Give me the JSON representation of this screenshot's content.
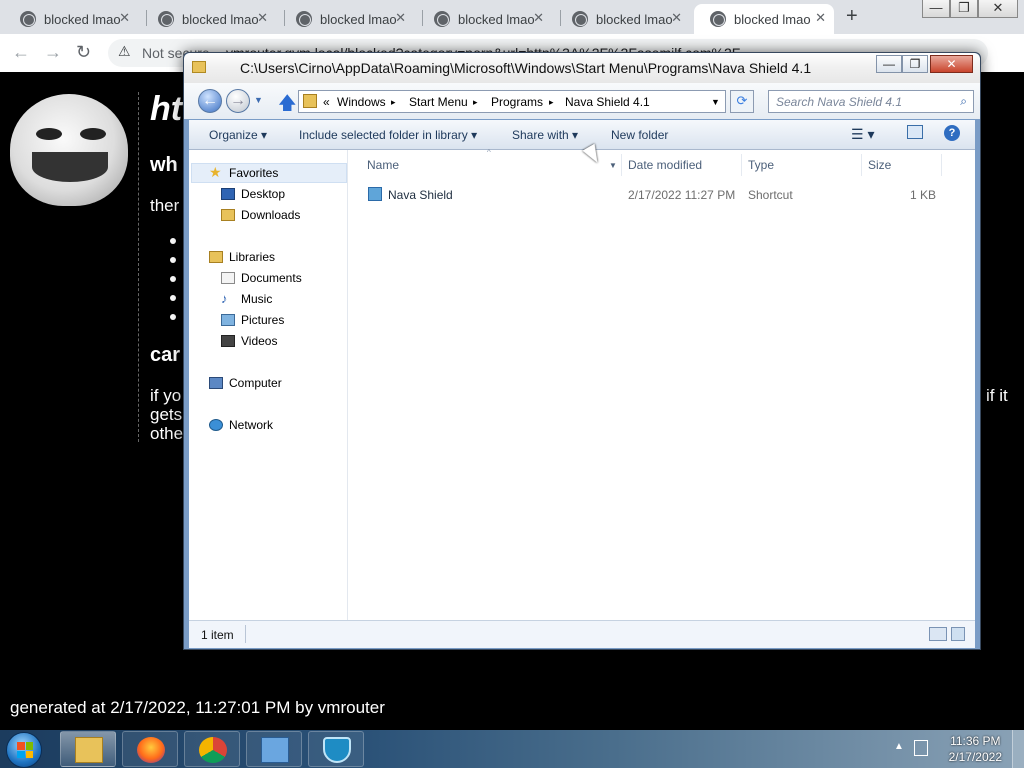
{
  "browser": {
    "tabs": [
      {
        "title": "blocked lmao"
      },
      {
        "title": "blocked lmao"
      },
      {
        "title": "blocked lmao"
      },
      {
        "title": "blocked lmao"
      },
      {
        "title": "blocked lmao"
      },
      {
        "title": "blocked lmao"
      }
    ],
    "tab_close_glyph": "✕",
    "new_tab_glyph": "+",
    "window_controls": {
      "minimize": "—",
      "restore": "❐",
      "close": "✕"
    },
    "omnibox": {
      "security_label": "Not secure",
      "url": "vmrouter.gvm.local/blocked?category=porn&url=http%3A%2F%2Fasemilf.com%2F"
    }
  },
  "blocked_page": {
    "heading": "ht",
    "subheading1": "wh",
    "line1": "ther",
    "subheading2": "car",
    "para_lines": [
      "if yo",
      "gets",
      "othe"
    ],
    "para_suffix": "if it",
    "footer": "generated at 2/17/2022, 11:27:01 PM by vmrouter"
  },
  "explorer": {
    "title": "C:\\Users\\Cirno\\AppData\\Roaming\\Microsoft\\Windows\\Start Menu\\Programs\\Nava Shield 4.1",
    "breadcrumb": {
      "prefix": "«",
      "items": [
        "Windows",
        "Start Menu",
        "Programs",
        "Nava Shield 4.1"
      ],
      "separator": "▸"
    },
    "search_placeholder": "Search Nava Shield 4.1",
    "commands": {
      "organize": "Organize ▾",
      "include": "Include selected folder in library ▾",
      "share": "Share with ▾",
      "new_folder": "New folder"
    },
    "nav": {
      "favorites": "Favorites",
      "desktop": "Desktop",
      "downloads": "Downloads",
      "libraries": "Libraries",
      "documents": "Documents",
      "music": "Music",
      "pictures": "Pictures",
      "videos": "Videos",
      "computer": "Computer",
      "network": "Network"
    },
    "columns": {
      "name": "Name",
      "date": "Date modified",
      "type": "Type",
      "size": "Size"
    },
    "files": [
      {
        "name": "Nava Shield",
        "date": "2/17/2022 11:27 PM",
        "type": "Shortcut",
        "size": "1 KB"
      }
    ],
    "status": "1 item"
  },
  "taskbar": {
    "time": "11:36 PM",
    "date": "2/17/2022",
    "apps": [
      "windows-explorer",
      "firefox",
      "chrome",
      "control-panel",
      "nava-shield"
    ]
  }
}
